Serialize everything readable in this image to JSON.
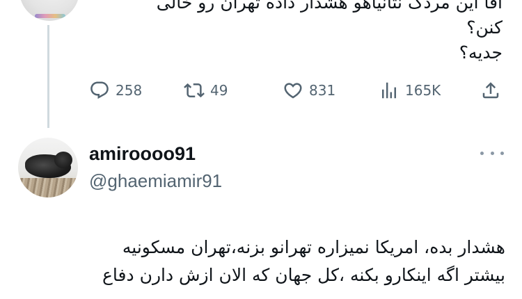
{
  "previous_tweet": {
    "lines": [
      "اقا این مردک نتانیاهو هشدار داده تهران رو خالی",
      "کنن؟",
      "جدیه؟"
    ],
    "actions": {
      "replies": "258",
      "retweets": "49",
      "likes": "831",
      "views": "165K"
    }
  },
  "main_tweet": {
    "display_name": "amiroooo91",
    "handle": "@ghaemiamir91",
    "lines": [
      "هشدار بده، امریکا نمیزاره تهرانو بزنه،تهران مسکونیه",
      "بیشتر اگه اینکارو بکنه ،کل جهان که الان ازش دارن دفاع"
    ]
  },
  "icons": {
    "reply": "reply-bubble-icon",
    "retweet": "retweet-arrows-icon",
    "like": "heart-icon",
    "views": "bar-chart-icon",
    "share": "share-upload-icon",
    "more": "more-dots-icon"
  },
  "colors": {
    "text": "#0f1419",
    "secondary": "#536471",
    "thread_line": "#cfd9de"
  }
}
